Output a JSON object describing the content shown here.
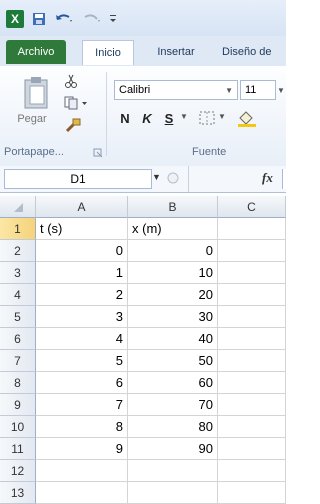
{
  "title_bar": {
    "app_icon": "X",
    "save_icon": "save-icon",
    "undo_icon": "undo-icon",
    "redo_icon": "redo-icon",
    "qa_menu": "qa-customize-icon"
  },
  "tabs": [
    {
      "label": "Archivo"
    },
    {
      "label": "Inicio"
    },
    {
      "label": "Insertar"
    },
    {
      "label": "Diseño de"
    }
  ],
  "ribbon": {
    "paste_label": "Pegar",
    "clipboard_group": "Portapape...",
    "font_name": "Calibri",
    "font_size": "11",
    "bold": "N",
    "italic": "K",
    "underline": "S",
    "font_group": "Fuente"
  },
  "formula_bar": {
    "name_box": "D1",
    "fx": "fx",
    "value": ""
  },
  "grid": {
    "columns": [
      "A",
      "B",
      "C"
    ],
    "rows": [
      {
        "n": "1",
        "a": "t (s)",
        "b": "x (m)"
      },
      {
        "n": "2",
        "a": "0",
        "b": "0"
      },
      {
        "n": "3",
        "a": "1",
        "b": "10"
      },
      {
        "n": "4",
        "a": "2",
        "b": "20"
      },
      {
        "n": "5",
        "a": "3",
        "b": "30"
      },
      {
        "n": "6",
        "a": "4",
        "b": "40"
      },
      {
        "n": "7",
        "a": "5",
        "b": "50"
      },
      {
        "n": "8",
        "a": "6",
        "b": "60"
      },
      {
        "n": "9",
        "a": "7",
        "b": "70"
      },
      {
        "n": "10",
        "a": "8",
        "b": "80"
      },
      {
        "n": "11",
        "a": "9",
        "b": "90"
      },
      {
        "n": "12",
        "a": "",
        "b": ""
      },
      {
        "n": "13",
        "a": "",
        "b": ""
      }
    ]
  }
}
